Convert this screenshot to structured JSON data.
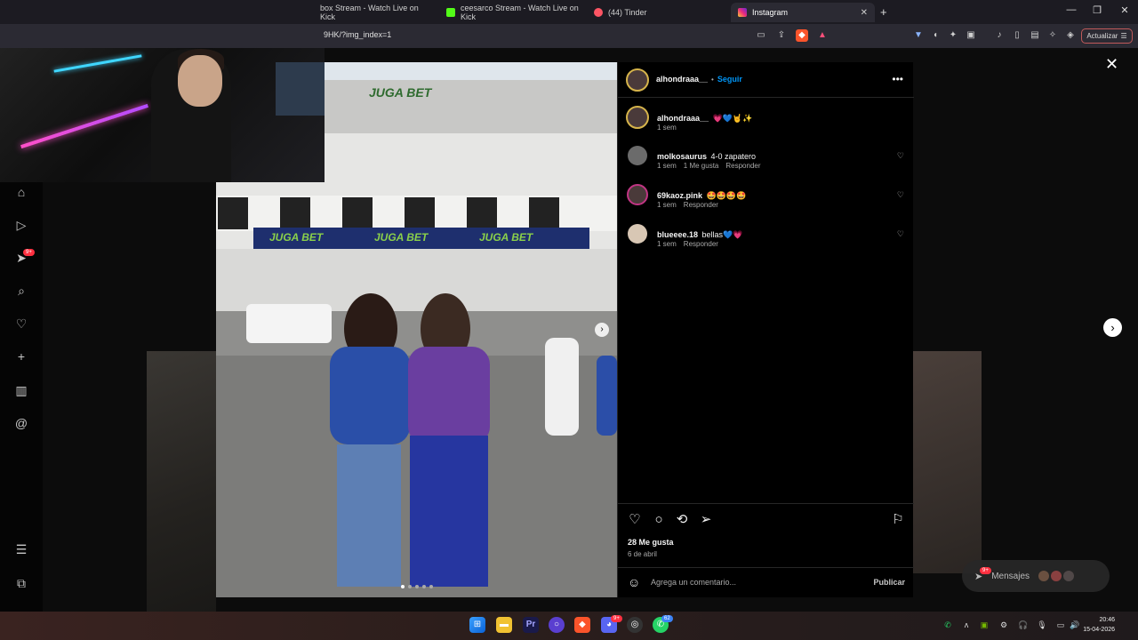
{
  "browser": {
    "tabs": [
      {
        "label": "box Stream - Watch Live on Kick",
        "icon": "kick-icon",
        "color": "#53fc18"
      },
      {
        "label": "ceesarco Stream - Watch Live on Kick",
        "icon": "kick-icon",
        "color": "#53fc18"
      },
      {
        "label": "(44) Tinder",
        "icon": "tinder-icon",
        "color": "#fd5564"
      },
      {
        "label": "Instagram",
        "icon": "instagram-icon",
        "color": "#e1306c"
      }
    ],
    "url": "9HK/?img_index=1",
    "update_button": "Actualizar"
  },
  "post": {
    "author": "alhondraaa__",
    "follow": "Seguir",
    "caption_author": "alhondraaa__",
    "caption": "💗💙🤘✨",
    "caption_time": "1 sem",
    "comments": [
      {
        "user": "molkosaurus",
        "text": "4-0 zapatero",
        "time": "1 sem",
        "likes": "1 Me gusta",
        "reply": "Responder"
      },
      {
        "user": "69kaoz.pink",
        "text": "🤩🤩🤩🤩",
        "time": "1 sem",
        "likes": "",
        "reply": "Responder"
      },
      {
        "user": "blueeee.18",
        "text": "bellas💙💗",
        "time": "1 sem",
        "likes": "",
        "reply": "Responder"
      }
    ],
    "likes": "28 Me gusta",
    "date": "6 de abril",
    "comment_placeholder": "Agrega un comentario...",
    "publish": "Publicar",
    "photo_sign": "JUGA BET"
  },
  "messages": {
    "label": "Mensajes",
    "badge": "9+"
  },
  "nav": {
    "badge": "9+"
  },
  "taskbar": {
    "time": "20:46",
    "date": "15-04-2026",
    "discord_badge": "9+",
    "whatsapp_badge": "62"
  },
  "colors": {
    "accent": "#0095f6",
    "like": "#ff3040"
  }
}
